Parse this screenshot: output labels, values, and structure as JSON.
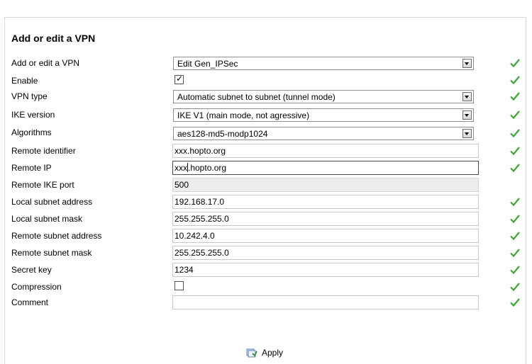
{
  "page_title": "Add or edit a VPN",
  "colors": {
    "check": "#3aa63a",
    "panel_border": "#d9d9d9"
  },
  "fields": {
    "vpn_select": {
      "label": "Add or edit a VPN",
      "value": "Edit Gen_IPSec"
    },
    "enable": {
      "label": "Enable",
      "checked": true,
      "check_glyph": "✓"
    },
    "vpn_type": {
      "label": "VPN type",
      "value": "Automatic subnet to subnet (tunnel mode)"
    },
    "ike_version": {
      "label": "IKE version",
      "value": "IKE V1 (main mode, not agressive)"
    },
    "algorithms": {
      "label": "Algorithms",
      "value": "aes128-md5-modp1024"
    },
    "remote_identifier": {
      "label": "Remote identifier",
      "value": "xxx.hopto.org"
    },
    "remote_ip": {
      "label": "Remote IP",
      "value_before_caret": "xxx",
      "value_after_caret": ".hopto.org"
    },
    "remote_ike_port": {
      "label": "Remote IKE port",
      "value": "500"
    },
    "local_subnet_address": {
      "label": "Local subnet address",
      "value": "192.168.17.0"
    },
    "local_subnet_mask": {
      "label": "Local subnet mask",
      "value": "255.255.255.0"
    },
    "remote_subnet_address": {
      "label": "Remote subnet address",
      "value": "10.242.4.0"
    },
    "remote_subnet_mask": {
      "label": "Remote subnet mask",
      "value": "255.255.255.0"
    },
    "secret_key": {
      "label": "Secret key",
      "value": "1234"
    },
    "compression": {
      "label": "Compression",
      "checked": false
    },
    "comment": {
      "label": "Comment",
      "value": ""
    }
  },
  "actions": {
    "apply_label": "Apply",
    "apply_icon": "apply-icon"
  },
  "status_icon": "green-check-icon"
}
